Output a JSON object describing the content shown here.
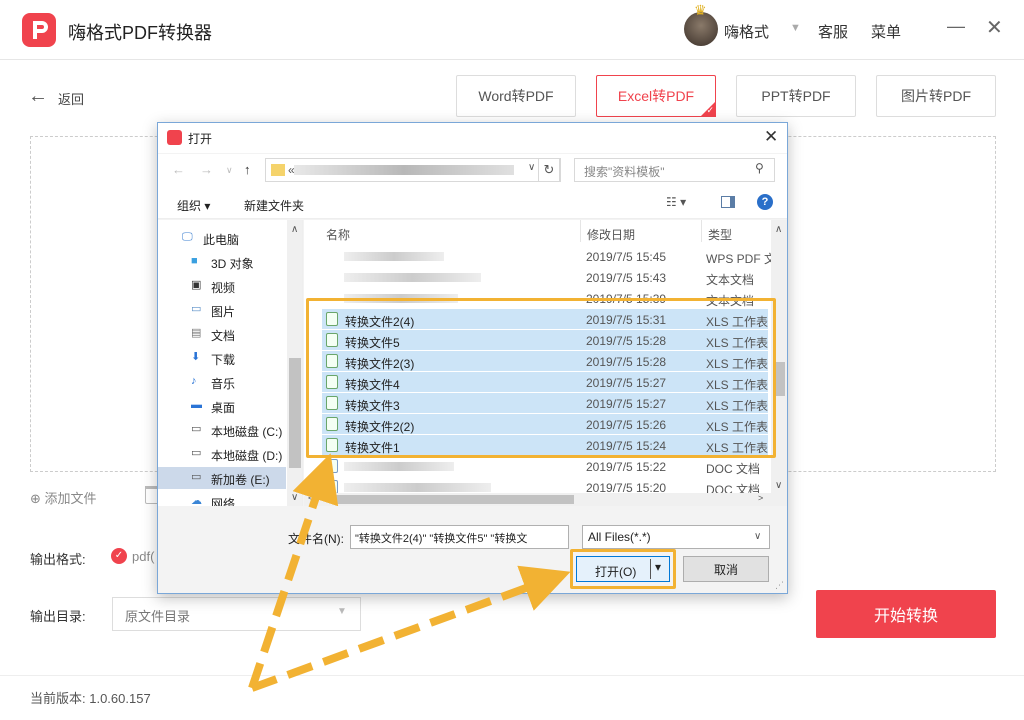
{
  "app": {
    "title": "嗨格式PDF转换器",
    "username": "嗨格式",
    "service": "客服",
    "menu": "菜单",
    "min_icon": "—",
    "close_icon": "✕"
  },
  "nav": {
    "back": "返回",
    "back_icon": "←"
  },
  "tabs": [
    {
      "label": "Word转PDF",
      "active": false
    },
    {
      "label": "Excel转PDF",
      "active": true
    },
    {
      "label": "PPT转PDF",
      "active": false
    },
    {
      "label": "图片转PDF",
      "active": false
    }
  ],
  "add_file": "⊕ 添加文件",
  "output_format": {
    "label": "输出格式:",
    "value": "pdf("
  },
  "output_dir": {
    "label": "输出目录:",
    "value": "原文件目录"
  },
  "start_button": "开始转换",
  "version": "当前版本: 1.0.60.157",
  "dialog": {
    "title": "打开",
    "address_prefix": "«",
    "search_placeholder": "搜索\"资料模板\"",
    "organize": "组织 ▾",
    "new_folder": "新建文件夹",
    "nav_items": [
      {
        "label": "此电脑",
        "icon": "computer-icon"
      },
      {
        "label": "3D 对象",
        "icon": "cube-icon"
      },
      {
        "label": "视频",
        "icon": "video-icon"
      },
      {
        "label": "图片",
        "icon": "picture-icon"
      },
      {
        "label": "文档",
        "icon": "document-icon"
      },
      {
        "label": "下载",
        "icon": "download-icon"
      },
      {
        "label": "音乐",
        "icon": "music-icon"
      },
      {
        "label": "桌面",
        "icon": "desktop-icon"
      },
      {
        "label": "本地磁盘 (C:)",
        "icon": "drive-icon"
      },
      {
        "label": "本地磁盘 (D:)",
        "icon": "drive-icon"
      },
      {
        "label": "新加卷 (E:)",
        "icon": "drive-icon",
        "selected": true
      },
      {
        "label": "网络",
        "icon": "network-icon"
      }
    ],
    "columns": {
      "name": "名称",
      "date": "修改日期",
      "type": "类型"
    },
    "files": [
      {
        "name": "",
        "date": "2019/7/5 15:45",
        "type": "WPS PDF 文",
        "blurred": true,
        "selected": false
      },
      {
        "name": "",
        "date": "2019/7/5 15:43",
        "type": "文本文档",
        "blurred": true,
        "selected": false
      },
      {
        "name": "",
        "date": "2019/7/5 15:39",
        "type": "文本文档",
        "blurred": true,
        "selected": false
      },
      {
        "name": "转换文件2(4)",
        "date": "2019/7/5 15:31",
        "type": "XLS 工作表",
        "selected": true
      },
      {
        "name": "转换文件5",
        "date": "2019/7/5 15:28",
        "type": "XLS 工作表",
        "selected": true
      },
      {
        "name": "转换文件2(3)",
        "date": "2019/7/5 15:28",
        "type": "XLS 工作表",
        "selected": true
      },
      {
        "name": "转换文件4",
        "date": "2019/7/5 15:27",
        "type": "XLS 工作表",
        "selected": true
      },
      {
        "name": "转换文件3",
        "date": "2019/7/5 15:27",
        "type": "XLS 工作表",
        "selected": true
      },
      {
        "name": "转换文件2(2)",
        "date": "2019/7/5 15:26",
        "type": "XLS 工作表",
        "selected": true
      },
      {
        "name": "转换文件1",
        "date": "2019/7/5 15:24",
        "type": "XLS 工作表",
        "selected": true
      },
      {
        "name": "",
        "date": "2019/7/5 15:22",
        "type": "DOC 文档",
        "blurred": true,
        "selected": false
      },
      {
        "name": "",
        "date": "2019/7/5 15:20",
        "type": "DOC 文档",
        "blurred": true,
        "selected": false
      }
    ],
    "filename_label": "文件名(N):",
    "filename_value": "\"转换文件2(4)\" \"转换文件5\" \"转换文",
    "filetype": "All Files(*.*)",
    "open": "打开(O)",
    "cancel": "取消"
  },
  "colors": {
    "accent": "#f0434d",
    "highlight": "#f2b233",
    "selection": "#cce4f7"
  }
}
